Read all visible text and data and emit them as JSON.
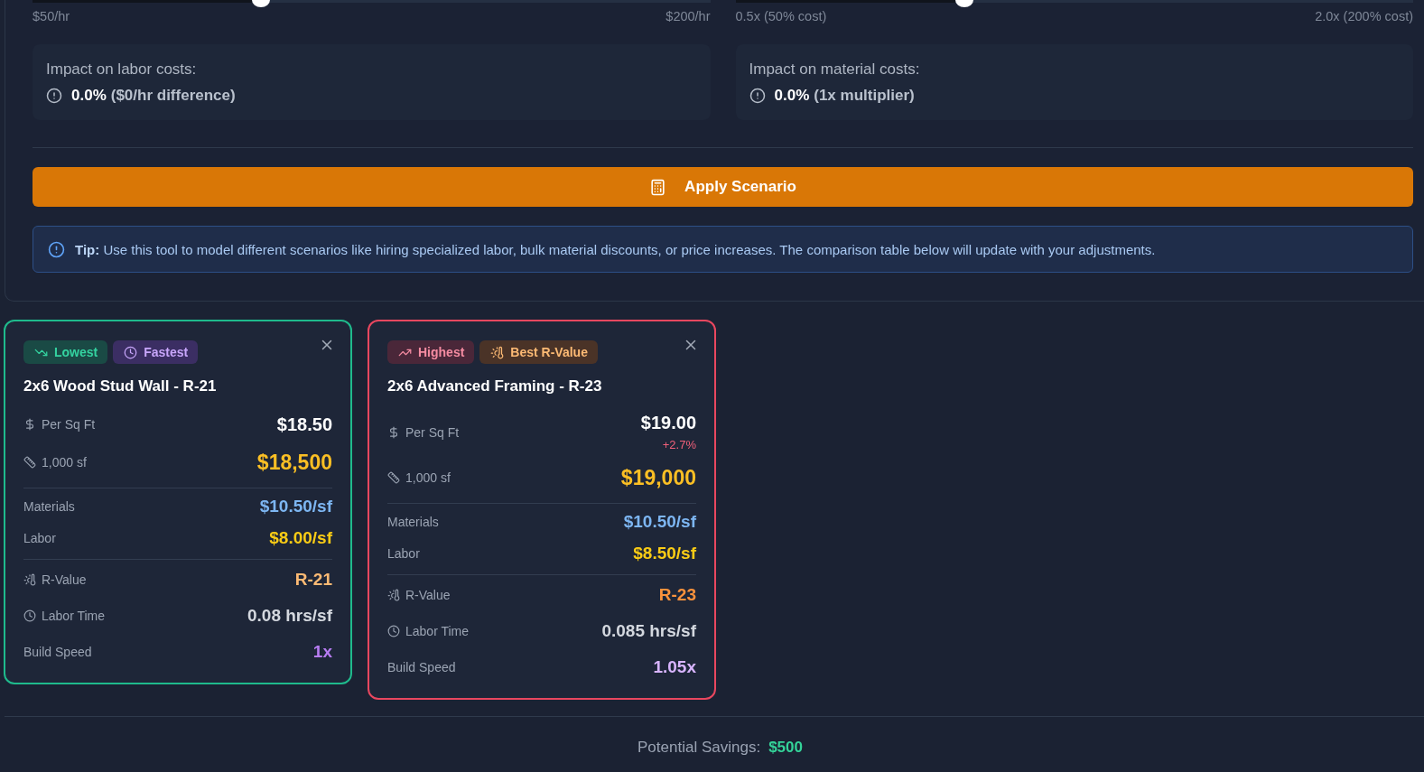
{
  "sliders": [
    {
      "level": 0.333,
      "min_label": "$50/hr",
      "max_label": "$200/hr",
      "impact": {
        "label": "Impact on labor costs:",
        "percent": "0.0%",
        "detail": "($0/hr difference)"
      }
    },
    {
      "level": 0.333,
      "min_label": "0.5x (50% cost)",
      "max_label": "2.0x (200% cost)",
      "impact": {
        "label": "Impact on material costs:",
        "percent": "0.0%",
        "detail": "(1x multiplier)"
      }
    }
  ],
  "apply_button": {
    "label": "Apply Scenario"
  },
  "tip": {
    "text": "**Tip:** Use this tool to model different scenarios like hiring specialized labor, bulk material discounts, or price increases. The comparison table below will update with your adjustments."
  },
  "cards": [
    {
      "color": "#1fba8c",
      "badges": [
        {
          "kind": "lowest",
          "label": "Lowest"
        },
        {
          "kind": "fastest",
          "label": "Fastest"
        }
      ],
      "title": "2x6 Wood Stud Wall - R-21",
      "groups": [
        {
          "rows": [
            {
              "kind": "per_sqft",
              "label": "Per Sq Ft",
              "value": "$18.50"
            },
            {
              "kind": "total",
              "label": "1,000 sf",
              "value": "$18,500"
            }
          ]
        },
        {
          "rows": [
            {
              "kind": "materials",
              "label": "Materials",
              "value": "$10.50/sf"
            },
            {
              "kind": "labor",
              "label": "Labor",
              "value": "$8.00/sf"
            }
          ]
        },
        {
          "rows": [
            {
              "kind": "r_value",
              "label": "R-Value",
              "value": "R-21",
              "best": false
            },
            {
              "kind": "labor_time",
              "label": "Labor Time",
              "value": "0.08 hrs/sf"
            },
            {
              "kind": "build_speed",
              "label": "Build Speed",
              "value": "1x",
              "best": true
            }
          ]
        }
      ]
    },
    {
      "color": "#e9475f",
      "badges": [
        {
          "kind": "highest",
          "label": "Highest"
        },
        {
          "kind": "best_r_value",
          "label": "Best R-Value"
        }
      ],
      "title": "2x6 Advanced Framing - R-23",
      "groups": [
        {
          "rows": [
            {
              "kind": "per_sqft",
              "label": "Per Sq Ft",
              "value": "$19.00",
              "delta": "+2.7%"
            },
            {
              "kind": "total",
              "label": "1,000 sf",
              "value": "$19,000"
            }
          ]
        },
        {
          "rows": [
            {
              "kind": "materials",
              "label": "Materials",
              "value": "$10.50/sf"
            },
            {
              "kind": "labor",
              "label": "Labor",
              "value": "$8.50/sf"
            }
          ]
        },
        {
          "rows": [
            {
              "kind": "r_value",
              "label": "R-Value",
              "value": "R-23",
              "best": true
            },
            {
              "kind": "labor_time",
              "label": "Labor Time",
              "value": "0.085 hrs/sf"
            },
            {
              "kind": "build_speed",
              "label": "Build Speed",
              "value": "1.05x",
              "best": false
            }
          ]
        }
      ]
    }
  ],
  "footer": {
    "label": "Potential Savings:",
    "value": "$500"
  }
}
